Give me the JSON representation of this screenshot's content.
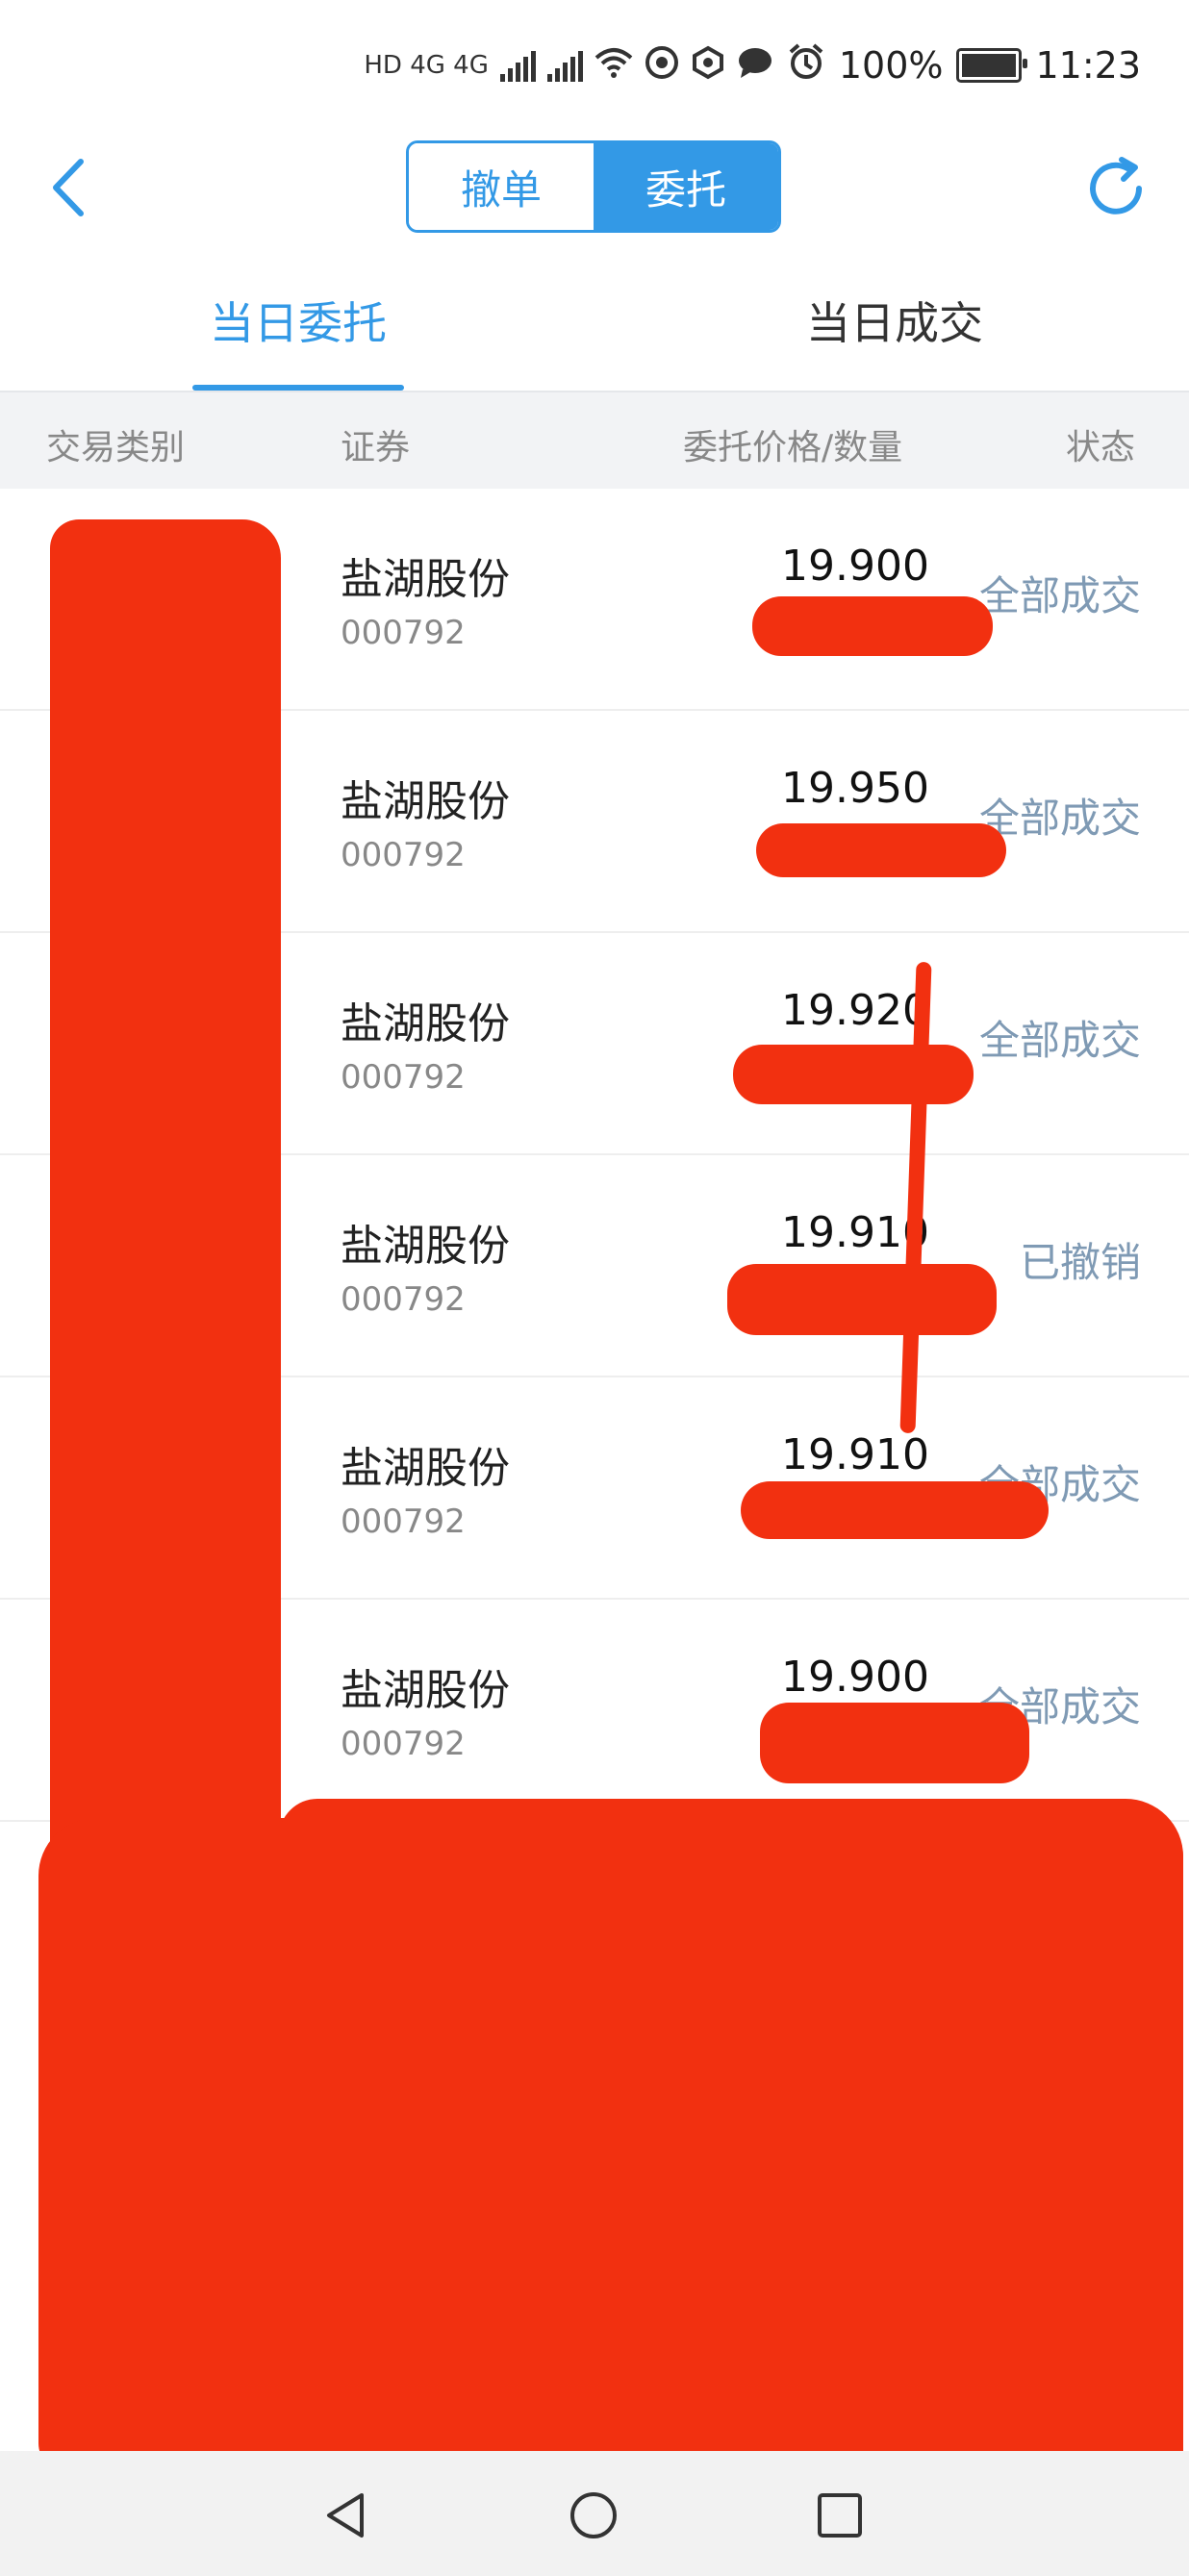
{
  "status_bar": {
    "network_labels": "HD 4G 4G",
    "battery": "100%",
    "time": "11:23"
  },
  "header": {
    "segment_cancel": "撤单",
    "segment_order": "委托"
  },
  "tabs": {
    "today_orders": "当日委托",
    "today_deals": "当日成交"
  },
  "columns": {
    "type": "交易类别",
    "security": "证券",
    "price_qty": "委托价格/数量",
    "status": "状态"
  },
  "orders": [
    {
      "name": "盐湖股份",
      "code": "000792",
      "price": "19.900",
      "status": "全部成交"
    },
    {
      "name": "盐湖股份",
      "code": "000792",
      "price": "19.950",
      "status": "全部成交"
    },
    {
      "name": "盐湖股份",
      "code": "000792",
      "price": "19.920",
      "status": "全部成交"
    },
    {
      "name": "盐湖股份",
      "code": "000792",
      "price": "19.910",
      "status": "已撤销"
    },
    {
      "name": "盐湖股份",
      "code": "000792",
      "price": "19.910",
      "status": "全部成交"
    },
    {
      "name": "盐湖股份",
      "code": "000792",
      "price": "19.900",
      "status": "全部成交"
    }
  ],
  "colors": {
    "accent": "#3399e6",
    "redaction": "#f23010",
    "status_text": "#7f9ab4"
  }
}
